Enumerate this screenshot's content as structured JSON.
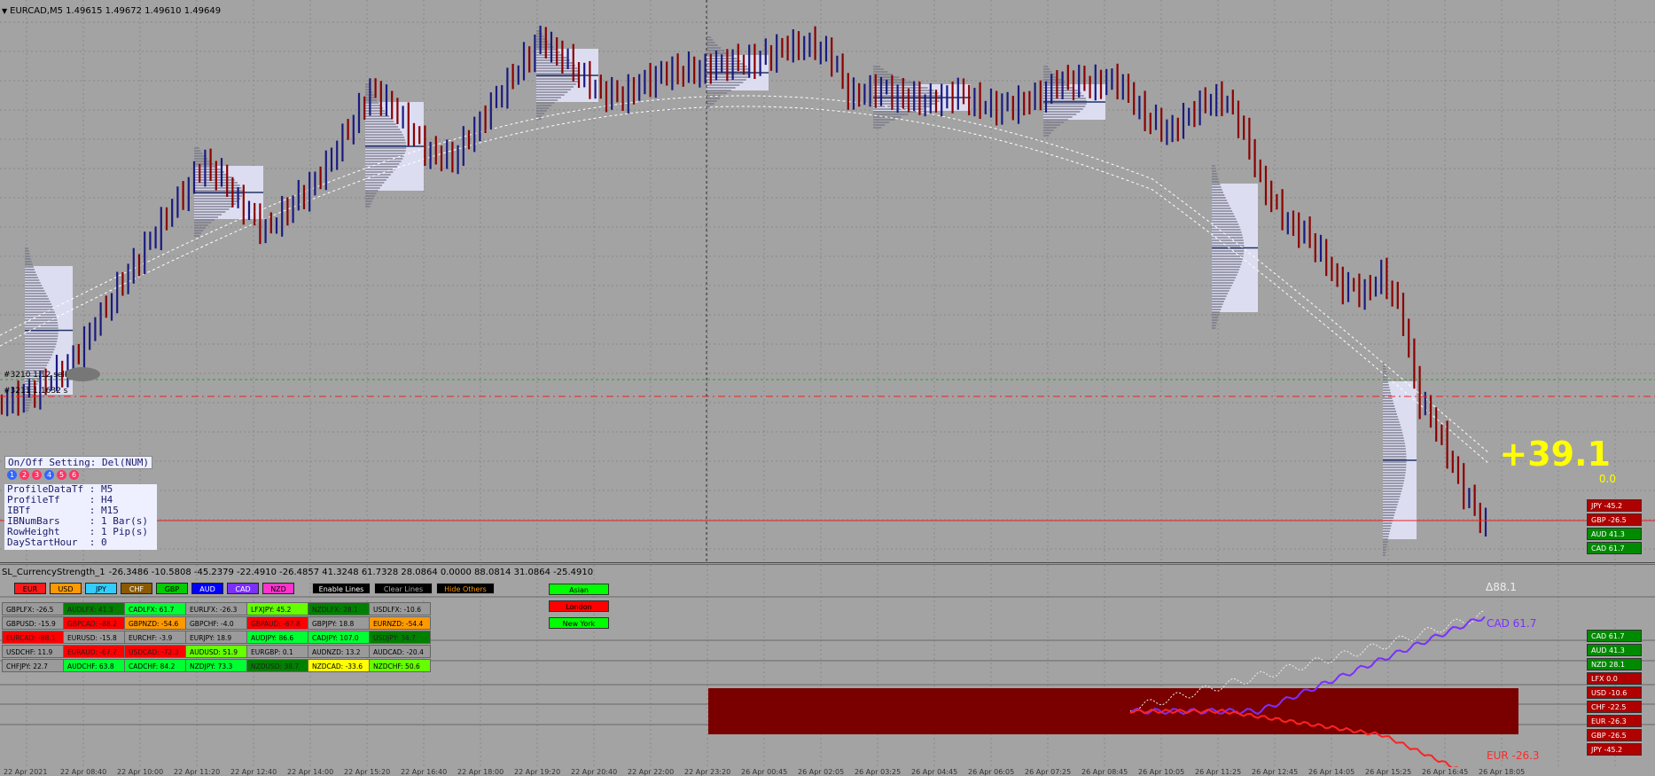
{
  "window": {
    "symbol_title": "EURCAD,M5  1.49615 1.49672 1.49610 1.49649"
  },
  "indicator": {
    "title": "SL_CurrencyStrength_1",
    "values": "-26.3486 -10.5808 -45.2379 -22.4910 -26.4857 41.3248 61.7328 28.0864 0.0000 88.0814 31.0864 -25.4910"
  },
  "orders": {
    "order1": "#3210 1.12 sell",
    "order2": "#3211 1.1632 s"
  },
  "profile_settings": {
    "onoff_label": "On/Off Setting: Del(NUM)",
    "dots": [
      "1",
      "2",
      "3",
      "4",
      "5",
      "6"
    ],
    "lines": [
      "ProfileDataTf : M5",
      "ProfileTf     : H4",
      "IBTf          : M15",
      "IBNumBars     : 1 Bar(s)",
      "RowHeight     : 1 Pip(s)",
      "DayStartHour  : 0"
    ]
  },
  "profit": {
    "big": "+39.1",
    "small": "0.0"
  },
  "main_strength": [
    {
      "label": "JPY -45.2",
      "color": "#b00000"
    },
    {
      "label": "GBP -26.5",
      "color": "#b00000"
    },
    {
      "label": "AUD 41.3",
      "color": "#008a00"
    },
    {
      "label": "CAD 61.7",
      "color": "#008a00"
    }
  ],
  "sub_strength": [
    {
      "label": "CAD 61.7",
      "color": "#008a00"
    },
    {
      "label": "AUD 41.3",
      "color": "#008a00"
    },
    {
      "label": "NZD 28.1",
      "color": "#008a00"
    },
    {
      "label": "LFX 0.0",
      "color": "#b00000"
    },
    {
      "label": "USD -10.6",
      "color": "#b00000"
    },
    {
      "label": "CHF -22.5",
      "color": "#b00000"
    },
    {
      "label": "EUR -26.3",
      "color": "#b00000"
    },
    {
      "label": "GBP -26.5",
      "color": "#b00000"
    },
    {
      "label": "JPY -45.2",
      "color": "#b00000"
    }
  ],
  "currency_buttons": [
    {
      "label": "EUR",
      "bg": "#ff1a1a",
      "fg": "#000"
    },
    {
      "label": "USD",
      "bg": "#ff9900",
      "fg": "#000"
    },
    {
      "label": "JPY",
      "bg": "#33ccff",
      "fg": "#000"
    },
    {
      "label": "CHF",
      "bg": "#8b5a00",
      "fg": "#fff"
    },
    {
      "label": "GBP",
      "bg": "#00cc00",
      "fg": "#000"
    },
    {
      "label": "AUD",
      "bg": "#0000ff",
      "fg": "#fff"
    },
    {
      "label": "CAD",
      "bg": "#7b2fff",
      "fg": "#fff"
    },
    {
      "label": "NZD",
      "bg": "#ff33cc",
      "fg": "#000"
    }
  ],
  "control_buttons": [
    {
      "label": "Enable Lines",
      "bg": "#000",
      "fg": "#fff"
    },
    {
      "label": "Clear Lines",
      "bg": "#000",
      "fg": "#aaa"
    },
    {
      "label": "Hide Others",
      "bg": "#000",
      "fg": "#ff9900"
    }
  ],
  "session_buttons": [
    {
      "label": "Asian",
      "bg": "#00ff00",
      "fg": "#000"
    },
    {
      "label": "London",
      "bg": "#ff0000",
      "fg": "#000"
    },
    {
      "label": "New York",
      "bg": "#00ff00",
      "fg": "#000"
    }
  ],
  "pairs": [
    [
      {
        "label": "GBPLFX: -26.5",
        "bg": "#9a9a9a"
      },
      {
        "label": "AUDLFX: 41.3",
        "bg": "#008000"
      },
      {
        "label": "CADLFX: 61.7",
        "bg": "#00ff33"
      },
      {
        "label": "EURLFX: -26.3",
        "bg": "#9a9a9a"
      },
      {
        "label": "LFXJPY: 45.2",
        "bg": "#66ff00"
      },
      {
        "label": "NZDLFX: 28.1",
        "bg": "#008000"
      },
      {
        "label": "USDLFX: -10.6",
        "bg": "#9a9a9a"
      }
    ],
    [
      {
        "label": "GBPUSD: -15.9",
        "bg": "#9a9a9a"
      },
      {
        "label": "GBPCAD: -88.2",
        "bg": "#ff0000"
      },
      {
        "label": "GBPNZD: -54.6",
        "bg": "#ff9900"
      },
      {
        "label": "GBPCHF: -4.0",
        "bg": "#9a9a9a"
      },
      {
        "label": "GBPAUD: -67.8",
        "bg": "#ff0000"
      },
      {
        "label": "GBPJPY: 18.8",
        "bg": "#9a9a9a"
      },
      {
        "label": "EURNZD: -54.4",
        "bg": "#ff9900"
      }
    ],
    [
      {
        "label": "EURCAD: -88.1",
        "bg": "#ff0000"
      },
      {
        "label": "EURUSD: -15.8",
        "bg": "#9a9a9a"
      },
      {
        "label": "EURCHF: -3.9",
        "bg": "#9a9a9a"
      },
      {
        "label": "EURJPY: 18.9",
        "bg": "#9a9a9a"
      },
      {
        "label": "AUDJPY: 86.6",
        "bg": "#00ff33"
      },
      {
        "label": "CADJPY: 107.0",
        "bg": "#00ff33"
      },
      {
        "label": "USDJPY: 34.7",
        "bg": "#008000"
      }
    ],
    [
      {
        "label": "USDCHF: 11.9",
        "bg": "#9a9a9a"
      },
      {
        "label": "EURAUD: -67.7",
        "bg": "#ff0000"
      },
      {
        "label": "USDCAD: -72.3",
        "bg": "#ff0000"
      },
      {
        "label": "AUDUSD: 51.9",
        "bg": "#66ff00"
      },
      {
        "label": "EURGBP: 0.1",
        "bg": "#9a9a9a"
      },
      {
        "label": "AUDNZD: 13.2",
        "bg": "#9a9a9a"
      },
      {
        "label": "AUDCAD: -20.4",
        "bg": "#9a9a9a"
      }
    ],
    [
      {
        "label": "CHFJPY: 22.7",
        "bg": "#9a9a9a"
      },
      {
        "label": "AUDCHF: 63.8",
        "bg": "#00ff33"
      },
      {
        "label": "CADCHF: 84.2",
        "bg": "#00ff33"
      },
      {
        "label": "NZDJPY: 73.3",
        "bg": "#00ff33"
      },
      {
        "label": "NZDUSD: 38.7",
        "bg": "#008000"
      },
      {
        "label": "NZDCAD: -33.6",
        "bg": "#ffff00"
      },
      {
        "label": "NZDCHF: 50.6",
        "bg": "#66ff00"
      }
    ]
  ],
  "line_labels": {
    "delta": "Δ88.1",
    "cad": "CAD  61.7",
    "eur": "EUR  -26.3"
  },
  "time_axis": [
    "22 Apr 2021",
    "22 Apr 08:40",
    "22 Apr 10:00",
    "22 Apr 11:20",
    "22 Apr 12:40",
    "22 Apr 14:00",
    "22 Apr 15:20",
    "22 Apr 16:40",
    "22 Apr 18:00",
    "22 Apr 19:20",
    "22 Apr 20:40",
    "22 Apr 22:00",
    "22 Apr 23:20",
    "26 Apr 00:45",
    "26 Apr 02:05",
    "26 Apr 03:25",
    "26 Apr 04:45",
    "26 Apr 06:05",
    "26 Apr 07:25",
    "26 Apr 08:45",
    "26 Apr 10:05",
    "26 Apr 11:25",
    "26 Apr 12:45",
    "26 Apr 14:05",
    "26 Apr 15:25",
    "26 Apr 16:45",
    "26 Apr 18:05"
  ],
  "colors": {
    "bull": "#1a1a80",
    "bear": "#8b0000",
    "profile_box": "#e8e8ff",
    "london_zone": "#7a0000"
  }
}
